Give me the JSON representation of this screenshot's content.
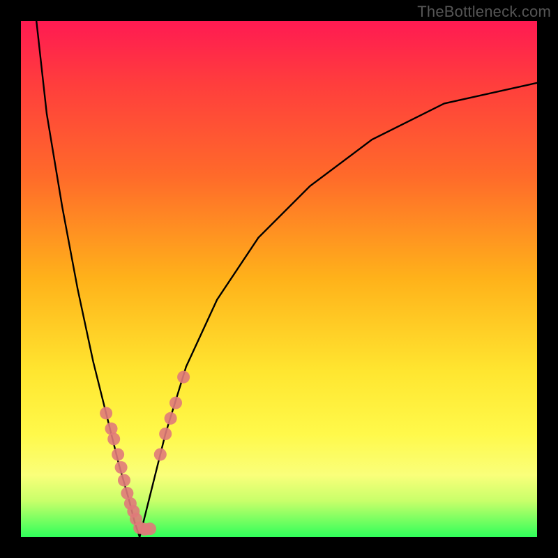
{
  "watermark": "TheBottleneck.com",
  "chart_data": {
    "type": "line",
    "title": "",
    "xlabel": "",
    "ylabel": "",
    "xlim": [
      0,
      100
    ],
    "ylim": [
      0,
      100
    ],
    "note": "V-shaped bottleneck curve; two branches meeting near x≈23, y≈0 over a red→yellow→green vertical gradient background; axes unlabeled.",
    "series": [
      {
        "name": "left-branch",
        "x": [
          3,
          5,
          8,
          11,
          14,
          17,
          19,
          21,
          22,
          23
        ],
        "y": [
          100,
          82,
          64,
          48,
          34,
          22,
          14,
          7,
          3,
          0
        ]
      },
      {
        "name": "right-branch",
        "x": [
          23,
          25,
          28,
          32,
          38,
          46,
          56,
          68,
          82,
          100
        ],
        "y": [
          0,
          8,
          20,
          33,
          46,
          58,
          68,
          77,
          84,
          88
        ]
      }
    ],
    "markers": [
      {
        "name": "left-cluster",
        "x": [
          16.5,
          17.5,
          18,
          18.8,
          19.4,
          20,
          20.6,
          21.2,
          21.8,
          22.3,
          23,
          24,
          25
        ],
        "y": [
          24,
          21,
          19,
          16,
          13.5,
          11,
          8.5,
          6.5,
          5,
          3.5,
          1.8,
          1.5,
          1.6
        ]
      },
      {
        "name": "right-cluster",
        "x": [
          27,
          28,
          29,
          30,
          31.5
        ],
        "y": [
          16,
          20,
          23,
          26,
          31
        ]
      }
    ],
    "colors": {
      "curve": "#000000",
      "marker": "#e07a7a",
      "gradient_top": "#ff1a52",
      "gradient_mid": "#ffe630",
      "gradient_bottom": "#2fff5a"
    }
  }
}
